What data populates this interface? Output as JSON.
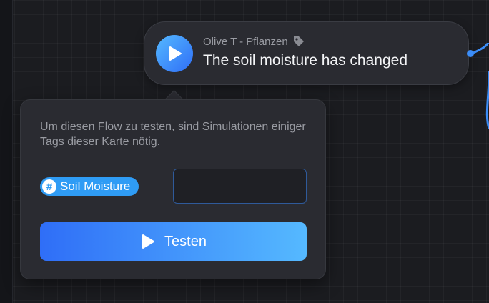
{
  "flow_card": {
    "subtitle": "Olive T - Pflanzen",
    "title": "The soil moisture has changed",
    "icons": {
      "play": "play-icon",
      "tag": "tag-icon"
    }
  },
  "test_popover": {
    "description": "Um diesen Flow zu testen, sind Simulationen einiger Tags dieser Karte nötig.",
    "tag": {
      "symbol": "#",
      "label": "Soil Moisture"
    },
    "value_input": {
      "value": "",
      "placeholder": ""
    },
    "test_button_label": "Testen"
  },
  "colors": {
    "accent_blue": "#2f6ef7",
    "accent_light_blue": "#55b9ff",
    "tag_blue": "#2f9cf5",
    "card_bg": "#2a2b31",
    "canvas_bg": "#1b1c20"
  }
}
